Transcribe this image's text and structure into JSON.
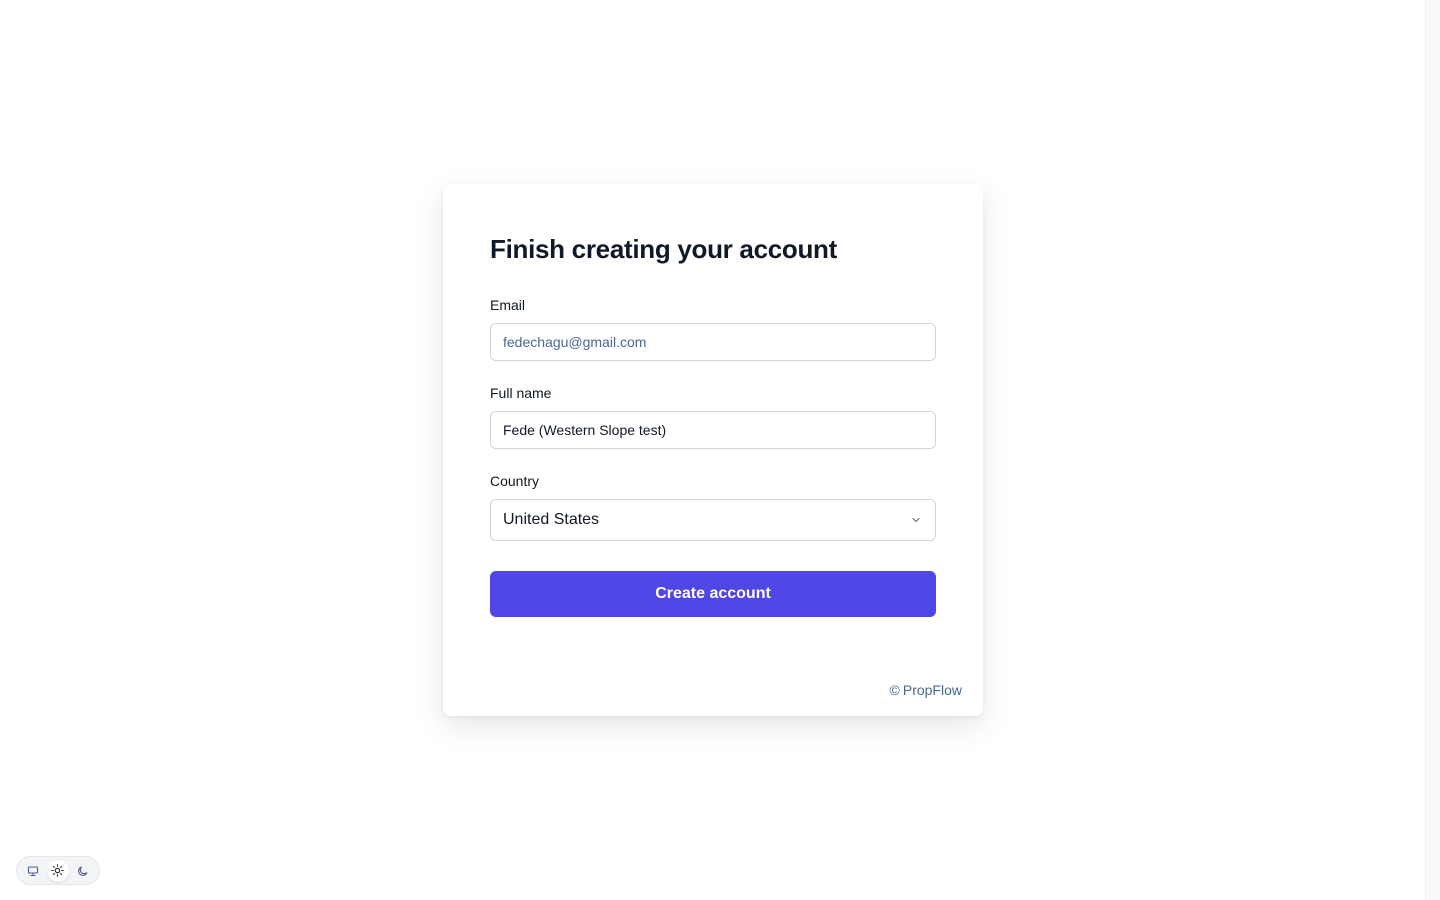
{
  "form": {
    "title": "Finish creating your account",
    "email_label": "Email",
    "email_value": "fedechagu@gmail.com",
    "fullname_label": "Full name",
    "fullname_value": "Fede (Western Slope test)",
    "country_label": "Country",
    "country_selected": "United States",
    "submit_label": "Create account"
  },
  "footer": {
    "copyright_symbol": "©",
    "brand": "PropFlow"
  },
  "theme_switcher": {
    "options": [
      "monitor-icon",
      "sun-icon",
      "moon-icon"
    ],
    "selected": "sun-icon"
  },
  "colors": {
    "accent": "#4f46e5",
    "muted_text": "#4b6890",
    "heading": "#111827",
    "border": "#d1d5db"
  }
}
